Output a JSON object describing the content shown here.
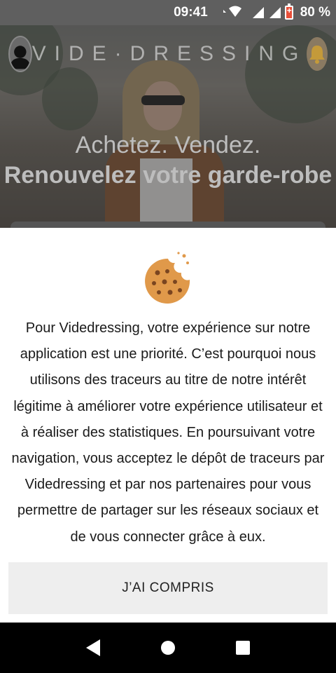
{
  "status_bar": {
    "time": "09:41",
    "battery_percent": "80 %"
  },
  "header": {
    "brand": "VIDE·DRESSING"
  },
  "hero": {
    "line1": "Achetez. Vendez.",
    "line2": "Renouvelez votre garde-robe"
  },
  "cookie_notice": {
    "icon": "cookie-icon",
    "text": "Pour Videdressing, votre expérience sur notre application est une priorité. C’est pourquoi nous utilisons des traceurs au titre de notre intérêt légitime à améliorer votre expérience utilisateur et à réaliser des statistiques. En poursuivant votre navigation, vous acceptez le dépôt de traceurs par Videdressing et par nos partenaires pour vous permettre de partager sur les réseaux sociaux et de vous connecter grâce à eux.",
    "button_label": "J’AI COMPRIS"
  },
  "colors": {
    "status_bar": "#5f5f5f",
    "sheet": "#ffffff",
    "button_bg": "#eeeeee",
    "cookie": "#e0994a"
  }
}
